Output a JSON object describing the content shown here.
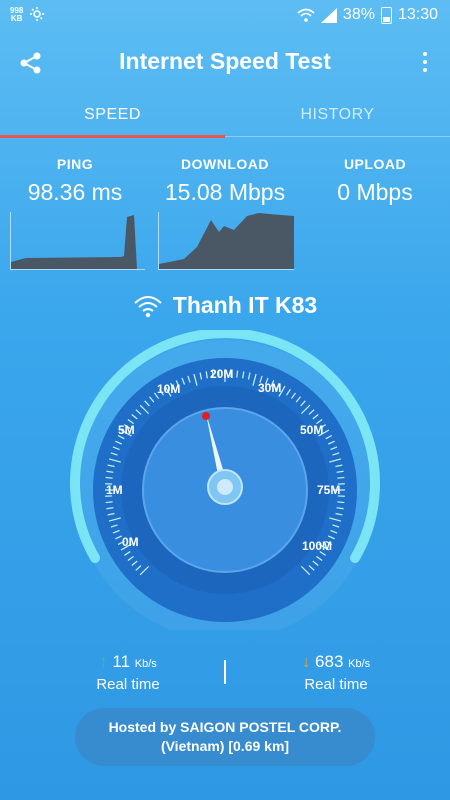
{
  "status_bar": {
    "kb_rate_value": "998",
    "kb_rate_unit": "KB",
    "battery": "38%",
    "time": "13:30"
  },
  "app": {
    "title": "Internet Speed Test"
  },
  "tabs": [
    {
      "label": "SPEED",
      "active": true
    },
    {
      "label": "HISTORY",
      "active": false
    }
  ],
  "stats": {
    "ping": {
      "label": "PING",
      "value": "98.36 ms"
    },
    "download": {
      "label": "DOWNLOAD",
      "value": "15.08 Mbps"
    },
    "upload": {
      "label": "UPLOAD",
      "value": "0 Mbps"
    }
  },
  "network_name": "Thanh IT K83",
  "gauge": {
    "labels": [
      "0M",
      "1M",
      "5M",
      "10M",
      "20M",
      "30M",
      "50M",
      "75M",
      "100M"
    ],
    "needle_value_mbps": 15.08
  },
  "realtime": {
    "upload": {
      "value": "11",
      "unit": "Kb/s",
      "label": "Real time"
    },
    "download": {
      "value": "683",
      "unit": "Kb/s",
      "label": "Real time"
    }
  },
  "host": {
    "line1": "Hosted by SAIGON POSTEL CORP.",
    "line2": "(Vietnam) [0.69 km]"
  },
  "colors": {
    "tab_indicator": "#e8584f",
    "upload_arrow": "#2ecc71",
    "download_arrow": "#f0a030",
    "needle_dot": "#e02020"
  }
}
